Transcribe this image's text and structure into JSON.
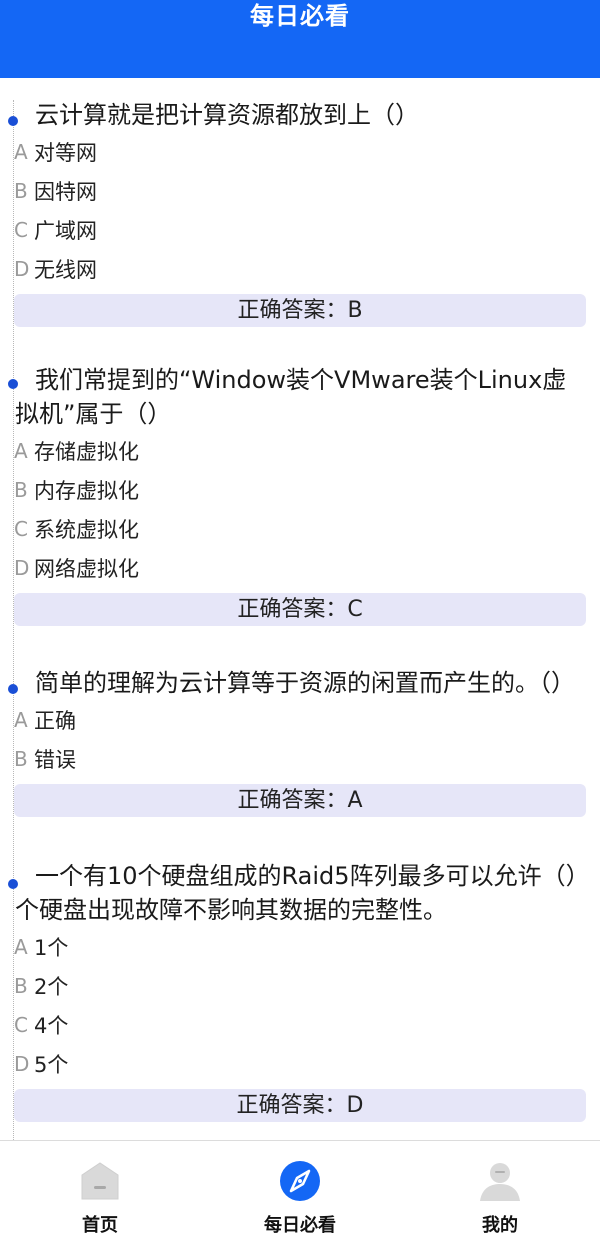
{
  "header": {
    "title": "每日必看"
  },
  "questions": [
    {
      "text": "云计算就是把计算资源都放到上（）",
      "options": [
        {
          "letter": "A",
          "text": "对等网"
        },
        {
          "letter": "B",
          "text": "因特网"
        },
        {
          "letter": "C",
          "text": "广域网"
        },
        {
          "letter": "D",
          "text": "无线网"
        }
      ],
      "answer": "正确答案：B"
    },
    {
      "text": "我们常提到的“Window装个VMware装个Linux虚拟机”属于（）",
      "options": [
        {
          "letter": "A",
          "text": "存储虚拟化"
        },
        {
          "letter": "B",
          "text": "内存虚拟化"
        },
        {
          "letter": "C",
          "text": "系统虚拟化"
        },
        {
          "letter": "D",
          "text": "网络虚拟化"
        }
      ],
      "answer": "正确答案：C"
    },
    {
      "text": "简单的理解为云计算等于资源的闲置而产生的。（）",
      "options": [
        {
          "letter": "A",
          "text": "正确"
        },
        {
          "letter": "B",
          "text": "错误"
        }
      ],
      "answer": "正确答案：A"
    },
    {
      "text": "一个有10个硬盘组成的Raid5阵列最多可以允许（）个硬盘出现故障不影响其数据的完整性。",
      "options": [
        {
          "letter": "A",
          "text": "1个"
        },
        {
          "letter": "B",
          "text": "2个"
        },
        {
          "letter": "C",
          "text": "4个"
        },
        {
          "letter": "D",
          "text": "5个"
        }
      ],
      "answer": "正确答案：D"
    }
  ],
  "tabbar": {
    "home": {
      "label": "首页",
      "icon": "home-icon",
      "active": false
    },
    "daily": {
      "label": "每日必看",
      "icon": "compass-icon",
      "active": true
    },
    "mine": {
      "label": "我的",
      "icon": "user-icon",
      "active": false
    }
  },
  "colors": {
    "header": "#1467f5",
    "accent": "#1a4fd6",
    "answer_bg": "#e6e6f8",
    "inactive_icon": "#d9d9d9"
  }
}
